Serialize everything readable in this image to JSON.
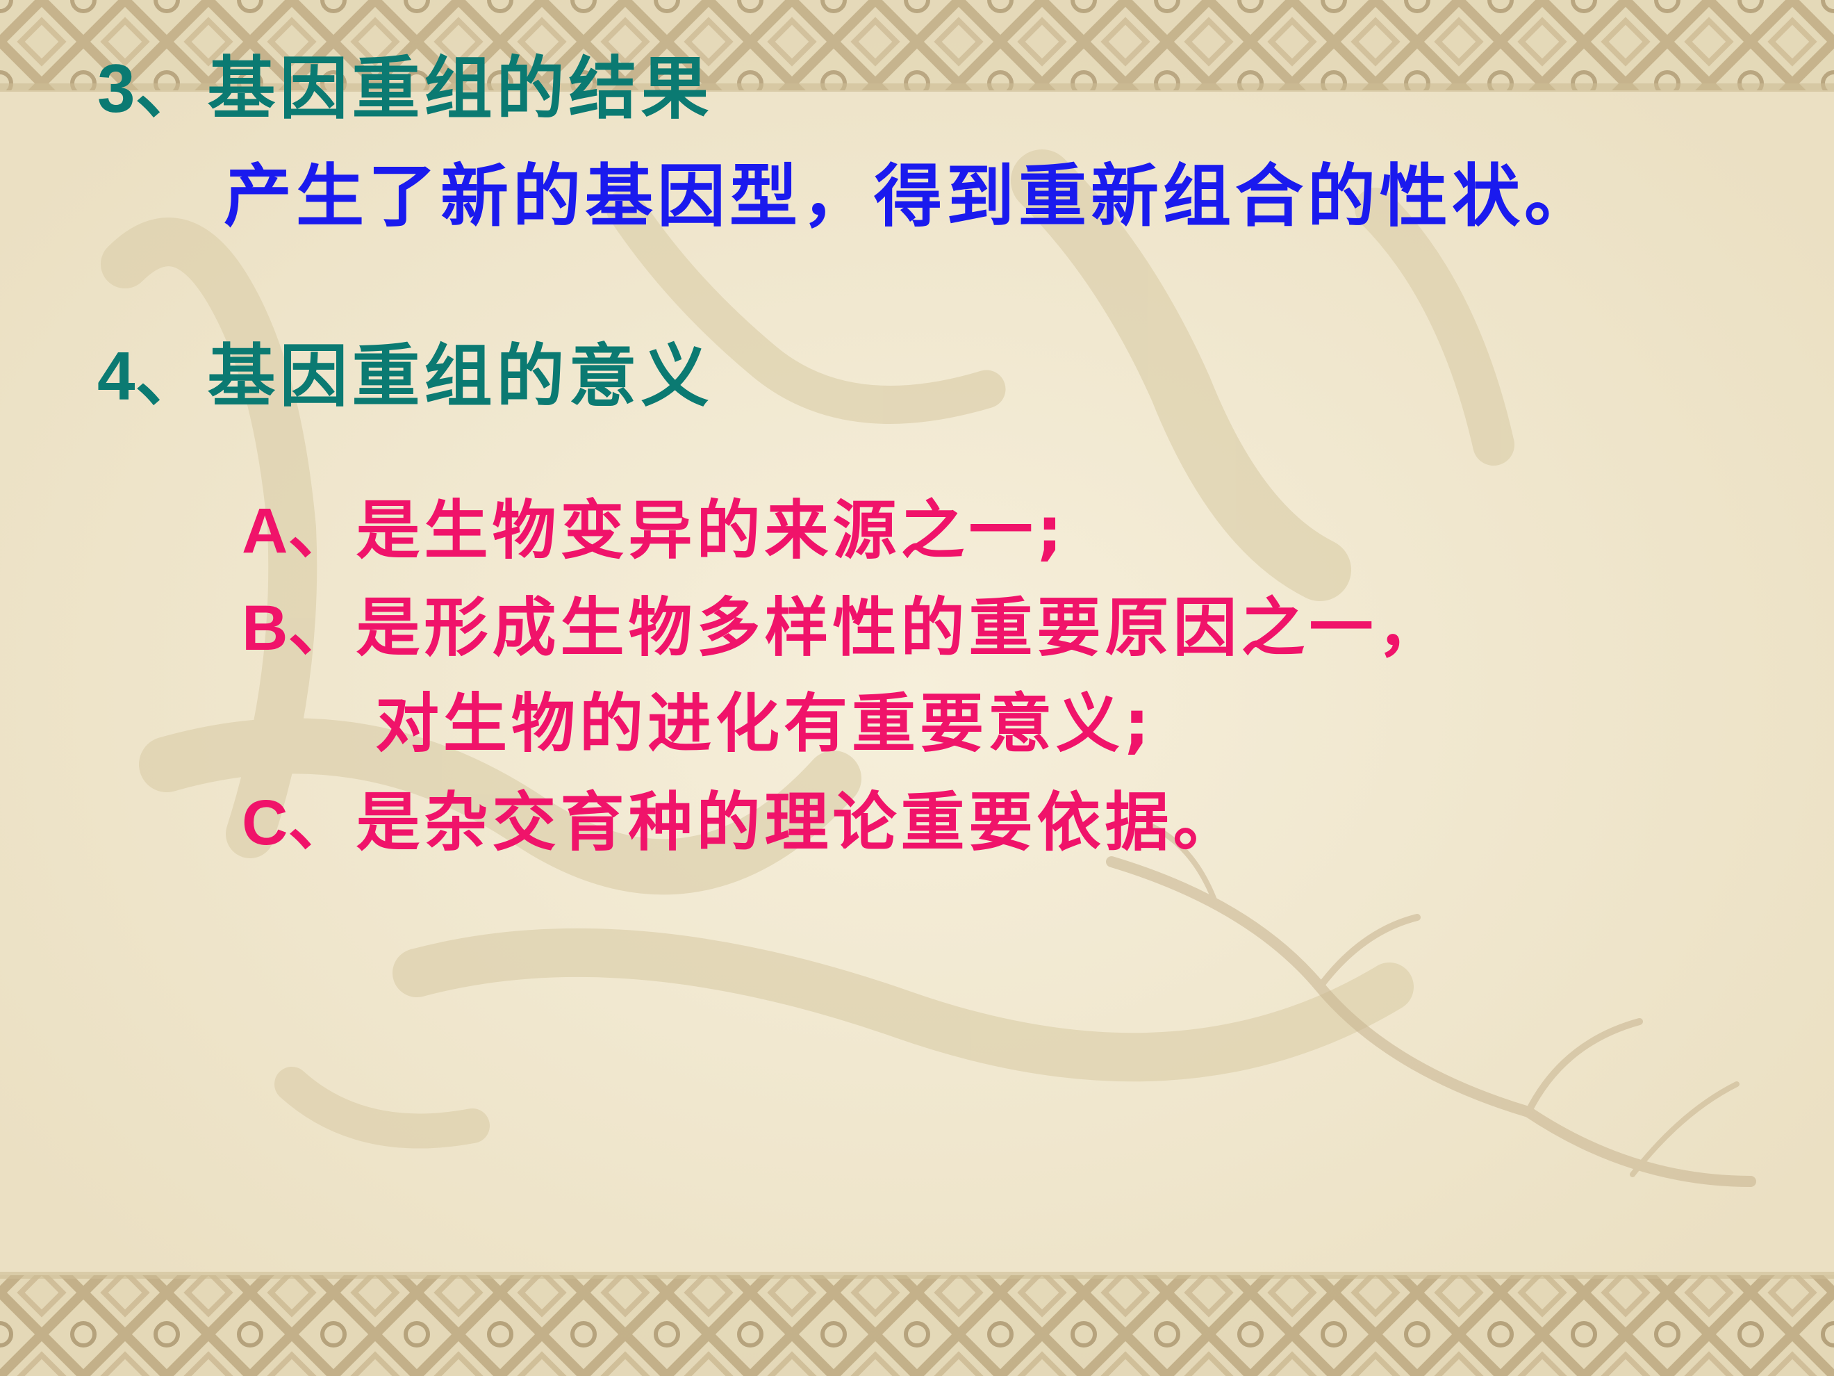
{
  "slide": {
    "heading_3": {
      "number": "3",
      "text": "、基因重组的结果"
    },
    "result_text": "产生了新的基因型，得到重新组合的性状。",
    "heading_4": {
      "number": "4",
      "text": "、基因重组的意义"
    },
    "items": [
      {
        "letter": "A",
        "text": "、是生物变异的来源之一;"
      },
      {
        "letter": "B",
        "text": "、是形成生物多样性的重要原因之一，"
      },
      {
        "letter": "",
        "text": "对生物的进化有重要意义;"
      },
      {
        "letter": "C",
        "text": "、是杂交育种的理论重要依据。"
      }
    ]
  },
  "colors": {
    "heading": "#0b7a72",
    "result": "#1a1aee",
    "items": "#f0136a",
    "background": "#f2ead3",
    "border_pattern": "#b9a47a"
  }
}
